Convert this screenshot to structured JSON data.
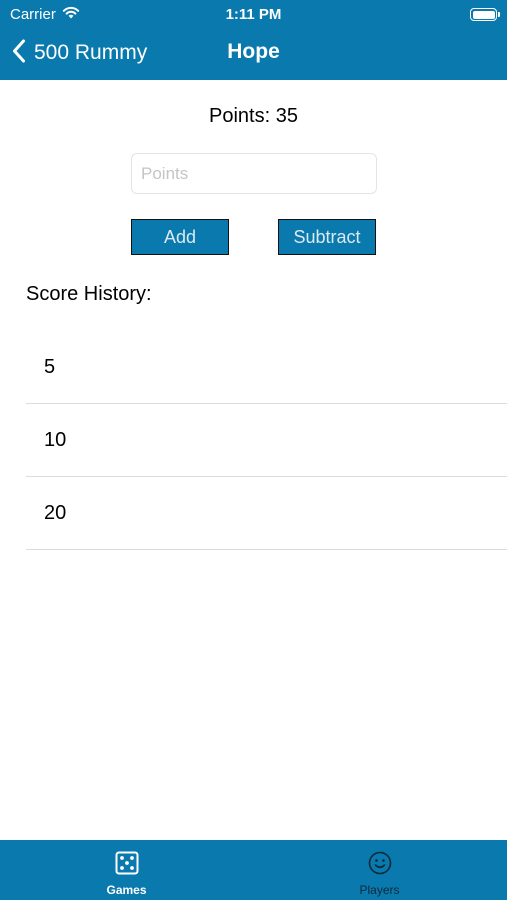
{
  "status_bar": {
    "carrier": "Carrier",
    "time": "1:11 PM"
  },
  "nav": {
    "back_label": "500 Rummy",
    "title": "Hope"
  },
  "points": {
    "display": "Points: 35",
    "input_placeholder": "Points",
    "input_value": ""
  },
  "buttons": {
    "add": "Add",
    "subtract": "Subtract"
  },
  "history": {
    "heading": "Score History:",
    "entries": [
      "5",
      "10",
      "20"
    ]
  },
  "tabbar": {
    "tabs": [
      {
        "label": "Games",
        "icon": "dice-icon",
        "selected": true
      },
      {
        "label": "Players",
        "icon": "smiley-icon",
        "selected": false
      }
    ]
  },
  "colors": {
    "brand": "#0a79ae",
    "tab_inactive": "#0b2a3a"
  }
}
